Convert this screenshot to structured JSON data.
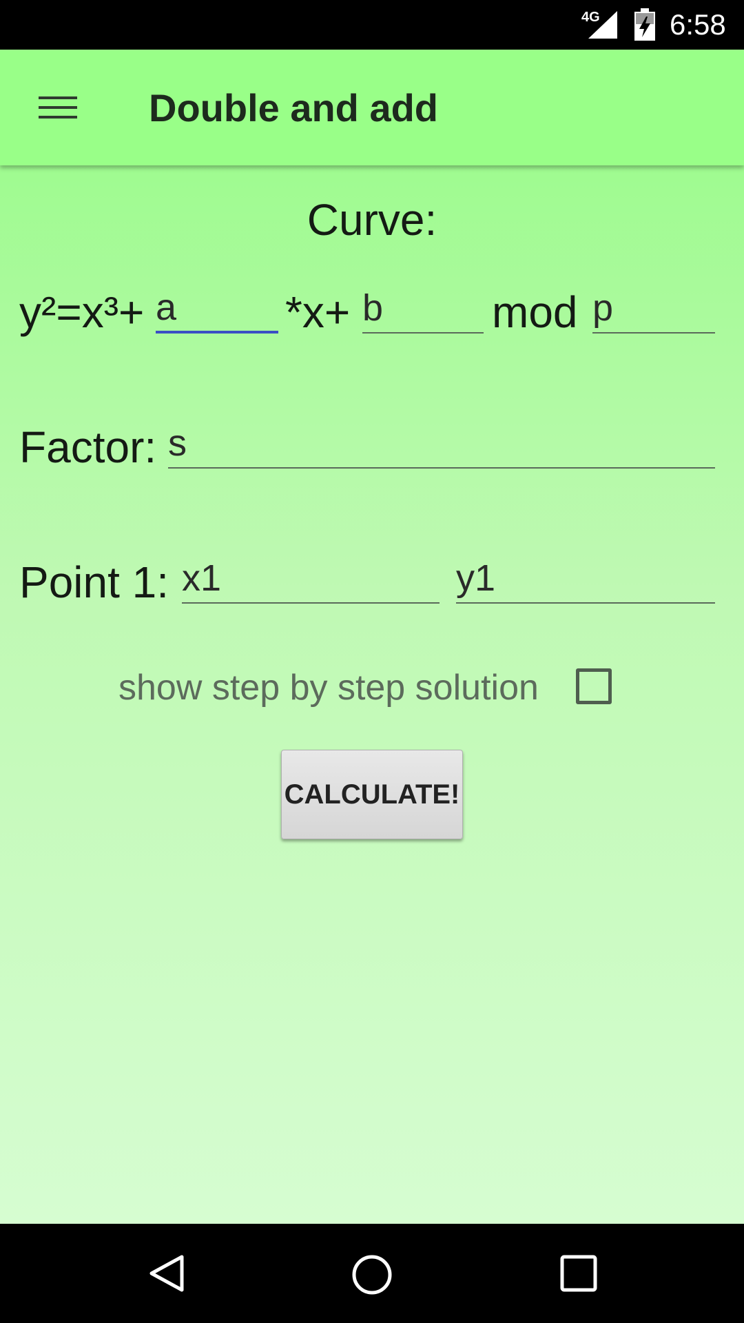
{
  "status_bar": {
    "network": "4G",
    "time": "6:58",
    "icons": [
      "signal-icon",
      "battery-icon"
    ]
  },
  "app_bar": {
    "title": "Double and add",
    "menu_icon": "hamburger-menu-icon",
    "background": "#99ff88"
  },
  "curve": {
    "heading": "Curve:",
    "equation_prefix": "y²=x³+",
    "a_placeholder": "a",
    "x_term": "*x+",
    "b_placeholder": "b",
    "mod_label": "mod",
    "p_placeholder": "p"
  },
  "factor": {
    "label": "Factor:",
    "placeholder": "s"
  },
  "point1": {
    "label": "Point 1:",
    "x_placeholder": "x1",
    "y_placeholder": "y1"
  },
  "step_by_step": {
    "label": "show step by step solution",
    "checked": false
  },
  "calculate_button": {
    "label": "CALCULATE!"
  },
  "nav_bar": {
    "icons": [
      "back-icon",
      "home-icon",
      "recents-icon"
    ]
  },
  "colors": {
    "accent_underline": "#3b4fc4",
    "content_top": "#9ffb90",
    "content_bottom": "#d6fdd1"
  }
}
